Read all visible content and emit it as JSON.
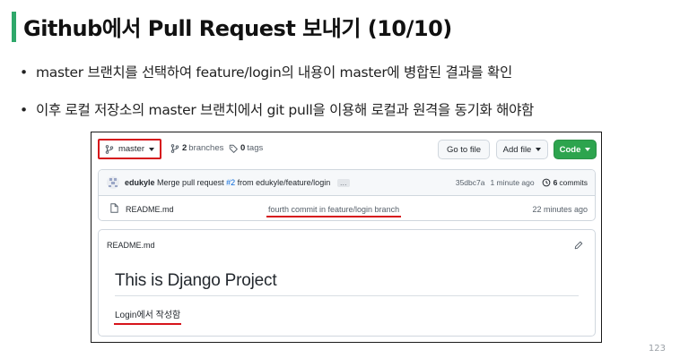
{
  "slide": {
    "title": "Github에서 Pull Request 보내기 (10/10)",
    "bullets": [
      "master 브랜치를 선택하여 feature/login의 내용이 master에 병합된 결과를 확인",
      "이후 로컬 저장소의 master 브랜치에서 git pull을 이용해 로컬과 원격을 동기화 해야함"
    ],
    "bullet_symbol": "•",
    "page_number": "123"
  },
  "repo": {
    "branch_label": "master",
    "branches_count": "2",
    "branches_label": "branches",
    "tags_count": "0",
    "tags_label": "tags",
    "goto_file_label": "Go to file",
    "add_file_label": "Add file",
    "code_label": "Code",
    "commit": {
      "author": "edukyle",
      "message_pre": "Merge pull request",
      "pr_ref": "#2",
      "message_post": "from edukyle/feature/login",
      "ellipsis": "…",
      "sha": "35dbc7a",
      "time": "1 minute ago",
      "count": "6",
      "count_label": "commits"
    },
    "file": {
      "name": "README.md",
      "commit_message": "fourth commit in feature/login branch",
      "time": "22 minutes ago"
    },
    "readme": {
      "header": "README.md",
      "heading": "This is Django Project",
      "text": "Login에서 작성함"
    }
  },
  "colors": {
    "title_bar": "#2fa86a",
    "highlight_red": "#d6141b",
    "github_green": "#2da44e",
    "link_blue": "#0969da"
  },
  "icons": [
    "branch-icon",
    "tag-icon",
    "history-icon",
    "file-icon",
    "pencil-icon",
    "avatar-icon"
  ]
}
